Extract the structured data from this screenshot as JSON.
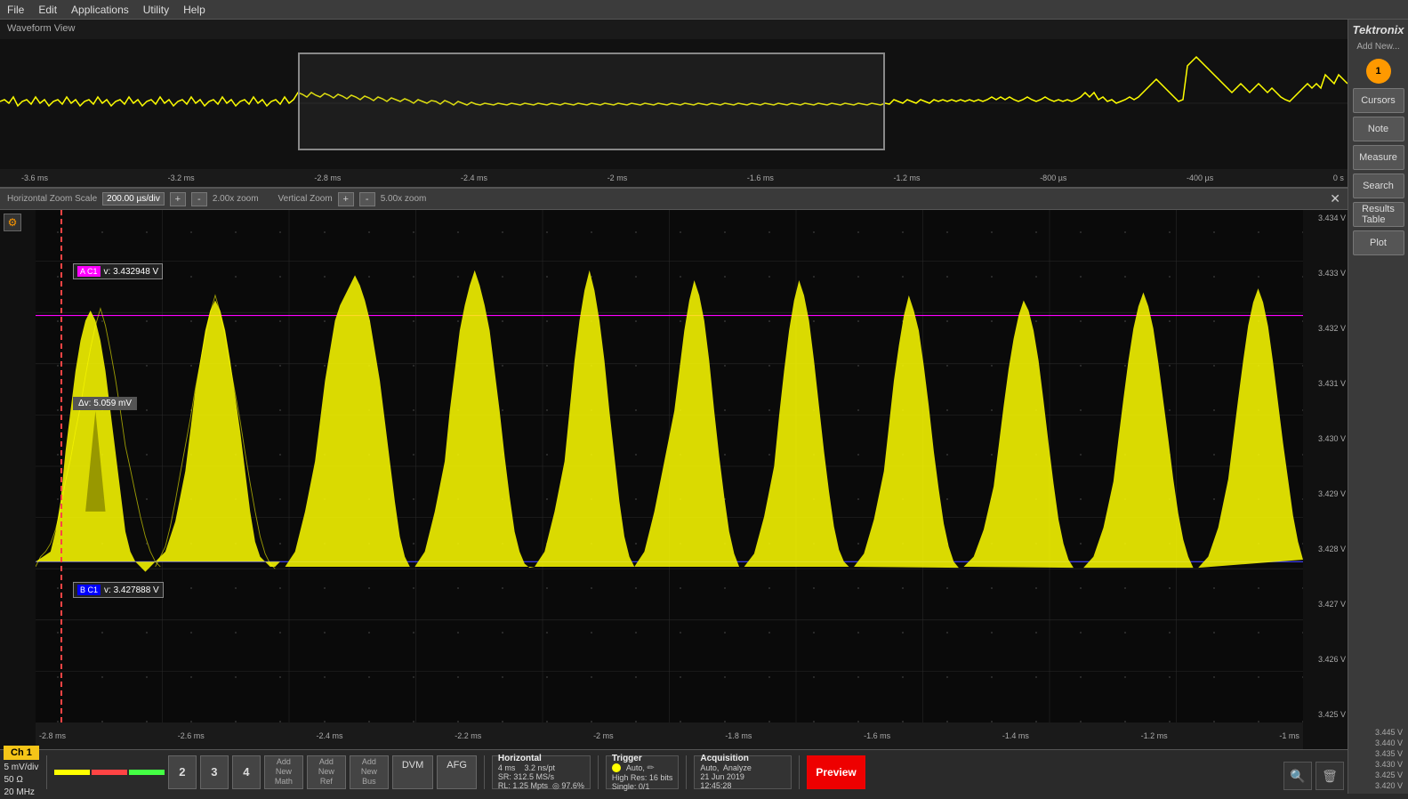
{
  "app": {
    "title": "Tektronix",
    "add_new": "Add New...",
    "menu": [
      "File",
      "Edit",
      "Applications",
      "Utility",
      "Help"
    ]
  },
  "right_panel": {
    "cursors_label": "Cursors",
    "note_label": "Note",
    "measure_label": "Measure",
    "search_label": "Search",
    "results_table_label": "Results\nTable",
    "plot_label": "Plot",
    "scale_labels": [
      "3.445 V",
      "3.440 V",
      "3.435 V",
      "3.430 V",
      "3.425 V",
      "3.420 V"
    ]
  },
  "overview": {
    "title": "Waveform View",
    "time_labels": [
      "-3.6 ms",
      "-3.2 ms",
      "-2.8 ms",
      "-2.4 ms",
      "-2 ms",
      "-1.6 ms",
      "-1.2 ms",
      "-800 µs",
      "-400 µs",
      "0 s"
    ]
  },
  "zoom_bar": {
    "h_zoom_scale_label": "Horizontal Zoom Scale",
    "h_zoom_value": "200.00 µs/div",
    "h_zoom_factor": "2.00x zoom",
    "v_zoom_label": "Vertical Zoom",
    "v_zoom_factor": "5.00x zoom",
    "plus_label": "+",
    "minus_label": "-"
  },
  "zoom_section": {
    "cursor_a_label": "v: 3.432948 V",
    "cursor_b_label": "v: 3.427888 V",
    "delta_label": "Δv: 5.059 mV",
    "ch_a": "A",
    "ch_b": "B",
    "ch1": "C1",
    "right_scale": [
      "3.434 V",
      "3.433 V",
      "3.432 V",
      "3.431 V",
      "3.430 V",
      "3.429 V",
      "3.428 V",
      "3.427 V",
      "3.426 V",
      "3.425 V"
    ],
    "time_labels": [
      "-2.8 ms",
      "-2.6 ms",
      "-2.4 ms",
      "-2.2 ms",
      "-2 ms",
      "-1.8 ms",
      "-1.6 ms",
      "-1.4 ms",
      "-1.2 ms",
      "-1 ms"
    ]
  },
  "status_bar": {
    "ch1_label": "Ch 1",
    "ch1_mv": "5 mV/div",
    "ch1_ohm": "50 Ω",
    "ch1_mhz": "20 MHz",
    "btn2": "2",
    "btn3": "3",
    "btn4": "4",
    "add_math": "Add\nNew\nMath",
    "add_ref": "Add\nNew\nRef",
    "add_bus": "Add\nNew\nBus",
    "dvm": "DVM",
    "afg": "AFG",
    "horiz_label": "Horizontal",
    "horiz_sr": "SR: 312.5 MS/s",
    "horiz_rl": "RL: 1.25 Mpts",
    "horiz_rate": "4 ms",
    "horiz_npts": "3.2 ns/pt",
    "horiz_pct": "◎ 97.6%",
    "trigger_label": "Trigger",
    "trigger_mode": "Auto,",
    "trigger_detail": "High Res: 16 bits",
    "acq_label": "Acquisition",
    "acq_mode": "Auto,",
    "acq_analyze": "Analyze",
    "acq_date": "21 Jun 2019",
    "acq_time": "12:45:28",
    "preview_label": "Preview",
    "single_label": "Single: 0/1"
  }
}
